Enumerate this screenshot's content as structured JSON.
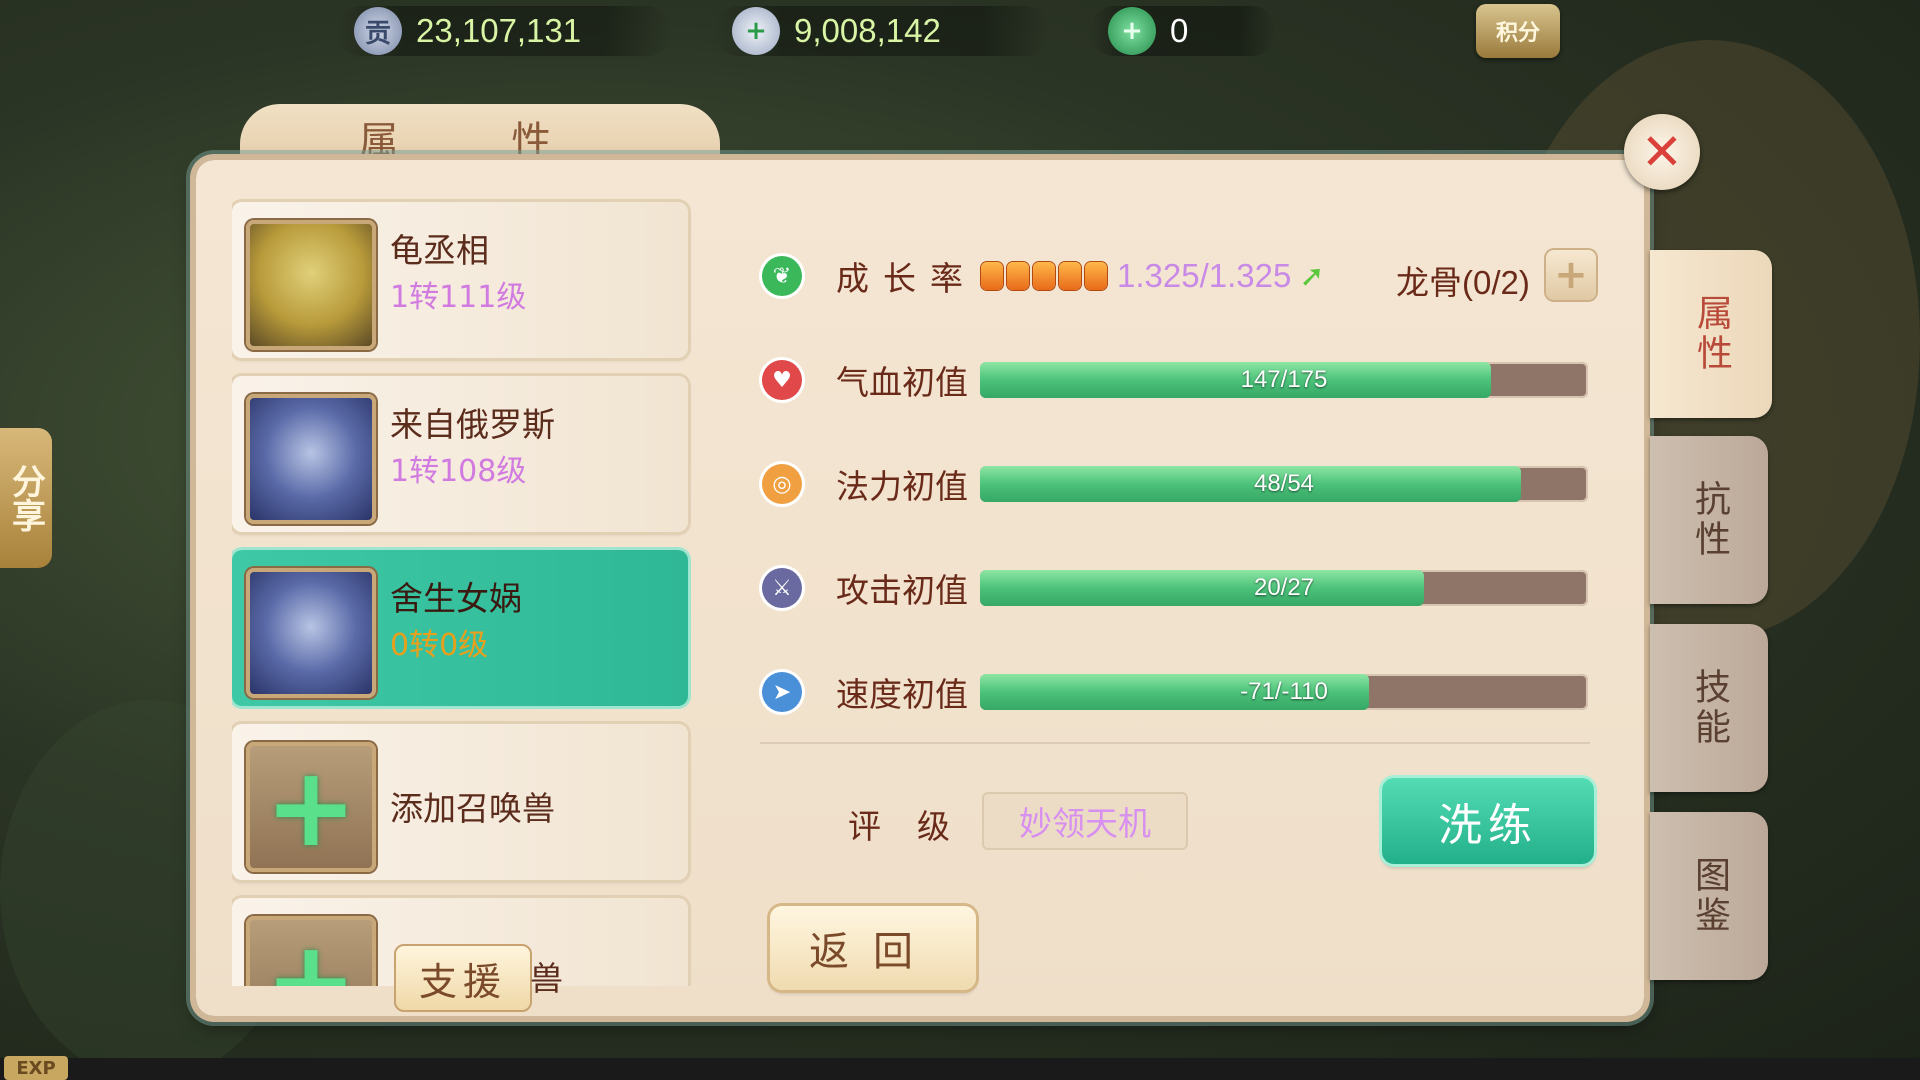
{
  "currency": {
    "contribution": {
      "icon": "contribution-coin-icon",
      "value": "23,107,131",
      "icon_glyph": "贡"
    },
    "silver": {
      "icon": "silver-ingot-icon",
      "value": "9,008,142"
    },
    "jade": {
      "icon": "jade-icon",
      "value": "0"
    },
    "score_label": "积分"
  },
  "panel": {
    "title": "属 性",
    "close_glyph": "✕"
  },
  "pets": [
    {
      "name": "龟丞相",
      "level": "1转111级",
      "avatar": "turtle"
    },
    {
      "name": "来自俄罗斯",
      "level": "1转108级",
      "avatar": "girl"
    },
    {
      "name": "舍生女娲",
      "level": "0转0级",
      "avatar": "girl",
      "selected": true
    }
  ],
  "add_slot": {
    "label": "添加召唤兽"
  },
  "support_slot": {
    "badge": "支援",
    "partial_label": "兽"
  },
  "growth": {
    "label": "成长率",
    "stars": 5,
    "value": "1.325/1.325",
    "dragon_bone": "龙骨(0/2)"
  },
  "stats": [
    {
      "label": "气血初值",
      "text": "147/175",
      "fill": 0.84,
      "icon_color": "#e0484a",
      "icon": "heart-icon"
    },
    {
      "label": "法力初值",
      "text": "48/54",
      "fill": 0.89,
      "icon_color": "#f0a040",
      "icon": "mana-icon"
    },
    {
      "label": "攻击初值",
      "text": "20/27",
      "fill": 0.73,
      "icon_color": "#6a6aa0",
      "icon": "sword-icon"
    },
    {
      "label": "速度初值",
      "text": "-71/-110",
      "fill": 0.64,
      "icon_color": "#4a90d8",
      "icon": "speed-icon"
    }
  ],
  "rating": {
    "label": "评级",
    "value": "妙领天机"
  },
  "buttons": {
    "wash": "洗练",
    "back": "返回"
  },
  "side_tabs": [
    "属性",
    "抗性",
    "技能",
    "图鉴"
  ],
  "share": {
    "label": "分享"
  },
  "exp": {
    "label": "EXP"
  },
  "colors": {
    "accent": "#2fb896",
    "panel": "#f4e6d3",
    "text": "#6a2a1a",
    "level": "#d17ae0"
  }
}
